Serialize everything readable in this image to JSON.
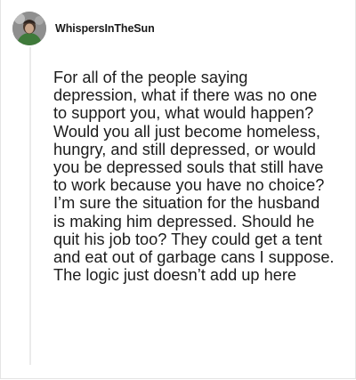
{
  "comment": {
    "username": "WhispersInTheSun",
    "avatar_icon": "user-avatar-icon",
    "body": "For all of the people saying depression, what if there was no one to support you, what would happen? Would you all just become homeless, hungry, and still depressed, or would you be depressed souls that still have to work because you have no choice? I’m sure the situation for the husband is making him depressed. Should he quit his job too? They could get a tent and eat out of garbage cans I suppose. The logic just doesn’t add up here"
  }
}
